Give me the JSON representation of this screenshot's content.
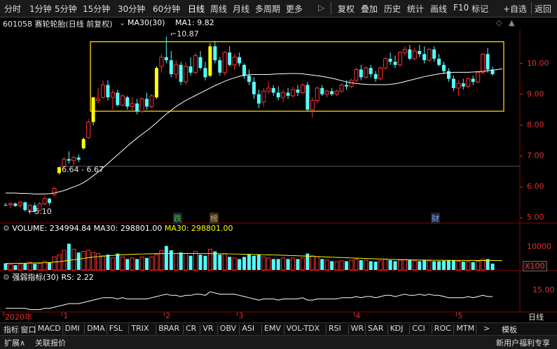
{
  "toolbar": {
    "periods": [
      "分时",
      "1分钟",
      "5分钟",
      "15分钟",
      "30分钟",
      "60分钟",
      "日线",
      "周线",
      "月线",
      "多周期",
      "更多"
    ],
    "active_period": "日线",
    "more_arrow": "▷",
    "actions": [
      "复权",
      "叠加",
      "历史",
      "统计",
      "画线",
      "F10",
      "标记"
    ],
    "add_fav": "+自选",
    "back": "返回"
  },
  "title": {
    "code_name": "601058 赛轮轮胎(日线 前复权)",
    "ma_setting": "MA30(30)",
    "ma_value": "MA1: 9.82",
    "icons": [
      "◇",
      "▲"
    ]
  },
  "annotations": {
    "high": "10.87",
    "low": "5.10",
    "gap": "6.64 - 6.67",
    "event_1": "跌",
    "event_2": "榜",
    "event_3": "财"
  },
  "volume_header": {
    "label": "VOLUME: 234994.84",
    "ma_label": "MA30: 298801.00",
    "ma_label_2": "MA30: 298801.00",
    "unit": "X100"
  },
  "rs_header": {
    "label": "强弱指标(30)",
    "value": "RS: 2.22"
  },
  "colors": {
    "up": "#ff3232",
    "down": "#54ffff",
    "limit": "#ffff00",
    "ma": "#ffffff",
    "box": "#ffd700"
  },
  "chart_data": {
    "type": "candlestick",
    "price_axis": [
      "10.00",
      "9.00",
      "8.00",
      "7.00",
      "6.00",
      "5.00"
    ],
    "price_range": [
      4.85,
      11.1
    ],
    "volume_axis": [
      "10000"
    ],
    "volume_range": [
      0,
      16000
    ],
    "rs_axis": [
      "15.00"
    ],
    "rs_range": [
      0,
      26
    ],
    "date_labels": [
      {
        "label": "2020年",
        "idx": 0
      },
      {
        "label": "1",
        "idx": 12
      },
      {
        "label": "2",
        "idx": 33
      },
      {
        "label": "3",
        "idx": 48
      },
      {
        "label": "4",
        "idx": 72
      },
      {
        "label": "5",
        "idx": 93
      }
    ],
    "candles": [
      {
        "o": 5.42,
        "h": 5.48,
        "l": 5.38,
        "c": 5.4,
        "v": 3000,
        "rs": 3
      },
      {
        "o": 5.42,
        "h": 5.5,
        "l": 5.3,
        "c": 5.46,
        "v": 2500,
        "rs": 3
      },
      {
        "o": 5.46,
        "h": 5.5,
        "l": 5.36,
        "c": 5.38,
        "v": 2200,
        "rs": 3
      },
      {
        "o": 5.4,
        "h": 5.55,
        "l": 5.32,
        "c": 5.5,
        "v": 2600,
        "rs": 3
      },
      {
        "o": 5.5,
        "h": 5.52,
        "l": 5.2,
        "c": 5.25,
        "v": 3000,
        "rs": 3
      },
      {
        "o": 5.25,
        "h": 5.45,
        "l": 5.1,
        "c": 5.4,
        "v": 3500,
        "rs": 2
      },
      {
        "o": 5.4,
        "h": 5.48,
        "l": 5.15,
        "c": 5.2,
        "v": 2800,
        "rs": 2
      },
      {
        "o": 5.25,
        "h": 5.52,
        "l": 5.2,
        "c": 5.45,
        "v": 3000,
        "rs": 2
      },
      {
        "o": 5.45,
        "h": 5.7,
        "l": 5.4,
        "c": 5.62,
        "v": 4000,
        "rs": 3
      },
      {
        "o": 5.62,
        "h": 5.65,
        "l": 5.4,
        "c": 5.48,
        "v": 3500,
        "rs": 3
      },
      {
        "o": 5.75,
        "h": 6.0,
        "l": 5.7,
        "c": 5.95,
        "v": 6000,
        "rs": 4
      },
      {
        "o": 6.45,
        "h": 6.64,
        "l": 6.4,
        "c": 6.64,
        "v": 7000,
        "rs": 5,
        "limit": true
      },
      {
        "o": 6.67,
        "h": 6.95,
        "l": 6.6,
        "c": 6.9,
        "v": 9000,
        "rs": 6
      },
      {
        "o": 6.9,
        "h": 7.15,
        "l": 6.75,
        "c": 6.85,
        "v": 12000,
        "rs": 7
      },
      {
        "o": 6.85,
        "h": 7.0,
        "l": 6.7,
        "c": 6.95,
        "v": 9500,
        "rs": 7
      },
      {
        "o": 6.95,
        "h": 7.05,
        "l": 6.8,
        "c": 6.88,
        "v": 8000,
        "rs": 7
      },
      {
        "o": 7.25,
        "h": 7.6,
        "l": 7.2,
        "c": 7.55,
        "v": 8500,
        "rs": 8,
        "limit": true
      },
      {
        "o": 7.6,
        "h": 8.2,
        "l": 7.55,
        "c": 8.1,
        "v": 9000,
        "rs": 9
      },
      {
        "o": 8.1,
        "h": 8.9,
        "l": 8.0,
        "c": 8.9,
        "v": 8000,
        "rs": 10,
        "limit": true
      },
      {
        "o": 8.8,
        "h": 9.2,
        "l": 8.7,
        "c": 8.85,
        "v": 7500,
        "rs": 11
      },
      {
        "o": 8.9,
        "h": 9.45,
        "l": 8.85,
        "c": 9.3,
        "v": 6500,
        "rs": 12
      },
      {
        "o": 9.3,
        "h": 9.45,
        "l": 8.8,
        "c": 8.9,
        "v": 7000,
        "rs": 12
      },
      {
        "o": 8.9,
        "h": 9.15,
        "l": 8.5,
        "c": 9.05,
        "v": 5500,
        "rs": 12
      },
      {
        "o": 9.05,
        "h": 9.15,
        "l": 8.6,
        "c": 8.65,
        "v": 7500,
        "rs": 11
      },
      {
        "o": 8.65,
        "h": 9.0,
        "l": 8.6,
        "c": 8.95,
        "v": 6000,
        "rs": 12
      },
      {
        "o": 8.9,
        "h": 8.95,
        "l": 8.5,
        "c": 8.6,
        "v": 5000,
        "rs": 11
      },
      {
        "o": 8.6,
        "h": 8.9,
        "l": 8.45,
        "c": 8.7,
        "v": 5500,
        "rs": 11
      },
      {
        "o": 8.7,
        "h": 8.85,
        "l": 8.35,
        "c": 8.45,
        "v": 5000,
        "rs": 11
      },
      {
        "o": 8.45,
        "h": 8.9,
        "l": 8.4,
        "c": 8.85,
        "v": 6000,
        "rs": 11
      },
      {
        "o": 8.85,
        "h": 9.05,
        "l": 8.5,
        "c": 8.6,
        "v": 5500,
        "rs": 11
      },
      {
        "o": 8.6,
        "h": 9.0,
        "l": 8.55,
        "c": 8.95,
        "v": 6000,
        "rs": 12
      },
      {
        "o": 8.9,
        "h": 9.9,
        "l": 8.85,
        "c": 9.85,
        "v": 7000,
        "rs": 13,
        "limit": true
      },
      {
        "o": 9.9,
        "h": 10.3,
        "l": 9.7,
        "c": 10.2,
        "v": 9000,
        "rs": 14
      },
      {
        "o": 10.2,
        "h": 10.87,
        "l": 10.0,
        "c": 10.1,
        "v": 11000,
        "rs": 15
      },
      {
        "o": 10.1,
        "h": 10.4,
        "l": 9.55,
        "c": 9.65,
        "v": 9000,
        "rs": 14
      },
      {
        "o": 9.65,
        "h": 10.1,
        "l": 9.5,
        "c": 9.95,
        "v": 7500,
        "rs": 14
      },
      {
        "o": 9.95,
        "h": 10.05,
        "l": 9.3,
        "c": 9.4,
        "v": 8000,
        "rs": 13
      },
      {
        "o": 9.4,
        "h": 10.05,
        "l": 9.3,
        "c": 9.9,
        "v": 7500,
        "rs": 14
      },
      {
        "o": 9.9,
        "h": 10.2,
        "l": 9.6,
        "c": 9.7,
        "v": 6500,
        "rs": 14
      },
      {
        "o": 9.7,
        "h": 10.35,
        "l": 9.65,
        "c": 10.25,
        "v": 8500,
        "rs": 15
      },
      {
        "o": 10.2,
        "h": 10.4,
        "l": 9.8,
        "c": 9.85,
        "v": 7000,
        "rs": 15
      },
      {
        "o": 9.85,
        "h": 10.05,
        "l": 9.45,
        "c": 9.55,
        "v": 6500,
        "rs": 14
      },
      {
        "o": 9.6,
        "h": 10.65,
        "l": 9.55,
        "c": 10.55,
        "v": 9500,
        "rs": 17,
        "limit": true
      },
      {
        "o": 10.55,
        "h": 10.7,
        "l": 10.0,
        "c": 10.1,
        "v": 8500,
        "rs": 16
      },
      {
        "o": 10.1,
        "h": 10.2,
        "l": 9.6,
        "c": 9.7,
        "v": 7000,
        "rs": 15
      },
      {
        "o": 9.7,
        "h": 10.4,
        "l": 9.6,
        "c": 10.35,
        "v": 7500,
        "rs": 15
      },
      {
        "o": 10.35,
        "h": 10.55,
        "l": 9.9,
        "c": 9.95,
        "v": 6000,
        "rs": 15
      },
      {
        "o": 9.95,
        "h": 10.3,
        "l": 9.8,
        "c": 10.2,
        "v": 5500,
        "rs": 15
      },
      {
        "o": 10.2,
        "h": 10.35,
        "l": 9.9,
        "c": 10.0,
        "v": 5000,
        "rs": 14
      },
      {
        "o": 9.95,
        "h": 10.0,
        "l": 9.5,
        "c": 9.6,
        "v": 6000,
        "rs": 13
      },
      {
        "o": 9.6,
        "h": 9.8,
        "l": 9.3,
        "c": 9.4,
        "v": 7000,
        "rs": 12
      },
      {
        "o": 9.4,
        "h": 9.55,
        "l": 8.85,
        "c": 9.0,
        "v": 6500,
        "rs": 11
      },
      {
        "o": 9.0,
        "h": 9.15,
        "l": 8.55,
        "c": 8.7,
        "v": 7000,
        "rs": 10
      },
      {
        "o": 8.75,
        "h": 9.2,
        "l": 8.6,
        "c": 9.1,
        "v": 6000,
        "rs": 11
      },
      {
        "o": 9.1,
        "h": 9.4,
        "l": 9.0,
        "c": 9.2,
        "v": 5500,
        "rs": 11
      },
      {
        "o": 9.2,
        "h": 9.3,
        "l": 8.95,
        "c": 9.05,
        "v": 5000,
        "rs": 11
      },
      {
        "o": 9.05,
        "h": 9.25,
        "l": 8.8,
        "c": 8.9,
        "v": 5000,
        "rs": 10
      },
      {
        "o": 8.9,
        "h": 9.15,
        "l": 8.75,
        "c": 9.05,
        "v": 5500,
        "rs": 11
      },
      {
        "o": 9.05,
        "h": 9.2,
        "l": 8.85,
        "c": 8.95,
        "v": 5000,
        "rs": 11
      },
      {
        "o": 8.95,
        "h": 9.25,
        "l": 8.9,
        "c": 9.15,
        "v": 5500,
        "rs": 11
      },
      {
        "o": 9.15,
        "h": 9.3,
        "l": 8.95,
        "c": 9.05,
        "v": 5000,
        "rs": 11
      },
      {
        "o": 9.05,
        "h": 9.35,
        "l": 9.0,
        "c": 9.3,
        "v": 5500,
        "rs": 12
      },
      {
        "o": 9.3,
        "h": 9.4,
        "l": 8.45,
        "c": 8.5,
        "v": 7500,
        "rs": 10
      },
      {
        "o": 8.5,
        "h": 8.9,
        "l": 8.25,
        "c": 8.8,
        "v": 6500,
        "rs": 10
      },
      {
        "o": 8.8,
        "h": 9.25,
        "l": 8.7,
        "c": 9.2,
        "v": 6000,
        "rs": 11
      },
      {
        "o": 9.2,
        "h": 9.3,
        "l": 8.95,
        "c": 9.0,
        "v": 5000,
        "rs": 11
      },
      {
        "o": 9.0,
        "h": 9.15,
        "l": 8.9,
        "c": 9.1,
        "v": 4500,
        "rs": 11
      },
      {
        "o": 9.1,
        "h": 9.2,
        "l": 8.95,
        "c": 9.0,
        "v": 4000,
        "rs": 11
      },
      {
        "o": 9.0,
        "h": 9.15,
        "l": 8.95,
        "c": 9.1,
        "v": 3800,
        "rs": 11
      },
      {
        "o": 9.1,
        "h": 9.35,
        "l": 9.05,
        "c": 9.3,
        "v": 4200,
        "rs": 12
      },
      {
        "o": 9.3,
        "h": 9.45,
        "l": 9.15,
        "c": 9.25,
        "v": 4000,
        "rs": 12
      },
      {
        "o": 9.25,
        "h": 9.5,
        "l": 9.2,
        "c": 9.45,
        "v": 4500,
        "rs": 12
      },
      {
        "o": 9.45,
        "h": 9.85,
        "l": 9.4,
        "c": 9.8,
        "v": 5000,
        "rs": 13
      },
      {
        "o": 9.8,
        "h": 9.95,
        "l": 9.45,
        "c": 9.55,
        "v": 4500,
        "rs": 12
      },
      {
        "o": 9.55,
        "h": 9.9,
        "l": 9.5,
        "c": 9.85,
        "v": 4500,
        "rs": 13
      },
      {
        "o": 9.85,
        "h": 9.95,
        "l": 9.55,
        "c": 9.65,
        "v": 4000,
        "rs": 13
      },
      {
        "o": 9.65,
        "h": 9.75,
        "l": 9.4,
        "c": 9.5,
        "v": 3800,
        "rs": 12
      },
      {
        "o": 9.5,
        "h": 9.9,
        "l": 9.45,
        "c": 9.85,
        "v": 4200,
        "rs": 13
      },
      {
        "o": 9.85,
        "h": 10.2,
        "l": 9.8,
        "c": 10.15,
        "v": 5000,
        "rs": 14
      },
      {
        "o": 10.15,
        "h": 10.35,
        "l": 9.95,
        "c": 10.05,
        "v": 4500,
        "rs": 14
      },
      {
        "o": 10.05,
        "h": 10.25,
        "l": 9.85,
        "c": 9.95,
        "v": 4000,
        "rs": 13
      },
      {
        "o": 9.95,
        "h": 10.4,
        "l": 9.9,
        "c": 10.35,
        "v": 4500,
        "rs": 14
      },
      {
        "o": 10.35,
        "h": 10.55,
        "l": 10.25,
        "c": 10.45,
        "v": 4800,
        "rs": 15
      },
      {
        "o": 10.45,
        "h": 10.6,
        "l": 10.1,
        "c": 10.15,
        "v": 4500,
        "rs": 14
      },
      {
        "o": 10.15,
        "h": 10.5,
        "l": 10.1,
        "c": 10.4,
        "v": 4200,
        "rs": 14
      },
      {
        "o": 10.4,
        "h": 10.6,
        "l": 10.2,
        "c": 10.3,
        "v": 4000,
        "rs": 15
      },
      {
        "o": 10.3,
        "h": 10.55,
        "l": 10.0,
        "c": 10.1,
        "v": 4500,
        "rs": 14
      },
      {
        "o": 10.1,
        "h": 10.5,
        "l": 10.05,
        "c": 10.45,
        "v": 4200,
        "rs": 15
      },
      {
        "o": 10.45,
        "h": 10.55,
        "l": 10.05,
        "c": 10.15,
        "v": 4000,
        "rs": 14
      },
      {
        "o": 10.15,
        "h": 10.3,
        "l": 9.9,
        "c": 9.95,
        "v": 4000,
        "rs": 14
      },
      {
        "o": 9.95,
        "h": 10.05,
        "l": 9.65,
        "c": 9.75,
        "v": 4200,
        "rs": 13
      },
      {
        "o": 9.75,
        "h": 9.85,
        "l": 9.4,
        "c": 9.5,
        "v": 4500,
        "rs": 12
      },
      {
        "o": 9.5,
        "h": 9.6,
        "l": 9.1,
        "c": 9.2,
        "v": 4500,
        "rs": 12
      },
      {
        "o": 9.2,
        "h": 9.45,
        "l": 8.95,
        "c": 9.35,
        "v": 4000,
        "rs": 12
      },
      {
        "o": 9.35,
        "h": 9.5,
        "l": 9.15,
        "c": 9.25,
        "v": 3800,
        "rs": 12
      },
      {
        "o": 9.25,
        "h": 9.55,
        "l": 9.2,
        "c": 9.5,
        "v": 3800,
        "rs": 13
      },
      {
        "o": 9.5,
        "h": 9.6,
        "l": 9.3,
        "c": 9.4,
        "v": 3600,
        "rs": 12
      },
      {
        "o": 9.4,
        "h": 9.75,
        "l": 9.35,
        "c": 9.7,
        "v": 4000,
        "rs": 13
      },
      {
        "o": 9.7,
        "h": 10.35,
        "l": 9.65,
        "c": 10.3,
        "v": 5000,
        "rs": 14
      },
      {
        "o": 10.3,
        "h": 10.5,
        "l": 9.7,
        "c": 9.8,
        "v": 5000,
        "rs": 13
      },
      {
        "o": 9.8,
        "h": 9.9,
        "l": 9.6,
        "c": 9.65,
        "v": 2900,
        "rs": 13
      }
    ],
    "ma30": [
      5.8,
      5.8,
      5.8,
      5.79,
      5.79,
      5.78,
      5.77,
      5.77,
      5.77,
      5.78,
      5.8,
      5.84,
      5.88,
      5.94,
      6.0,
      6.06,
      6.14,
      6.24,
      6.36,
      6.48,
      6.62,
      6.76,
      6.9,
      7.04,
      7.18,
      7.32,
      7.45,
      7.58,
      7.7,
      7.82,
      7.94,
      8.08,
      8.22,
      8.36,
      8.48,
      8.6,
      8.7,
      8.8,
      8.88,
      8.96,
      9.04,
      9.12,
      9.2,
      9.28,
      9.35,
      9.42,
      9.48,
      9.53,
      9.58,
      9.61,
      9.63,
      9.64,
      9.64,
      9.64,
      9.64,
      9.65,
      9.66,
      9.66,
      9.67,
      9.67,
      9.67,
      9.66,
      9.64,
      9.62,
      9.6,
      9.58,
      9.55,
      9.52,
      9.48,
      9.44,
      9.4,
      9.37,
      9.35,
      9.33,
      9.32,
      9.31,
      9.31,
      9.31,
      9.31,
      9.32,
      9.34,
      9.37,
      9.41,
      9.45,
      9.49,
      9.53,
      9.57,
      9.6,
      9.63,
      9.66,
      9.68,
      9.7,
      9.71,
      9.71,
      9.71,
      9.71,
      9.72,
      9.73,
      9.74,
      9.76,
      9.78,
      9.8,
      9.82
    ],
    "vol_ma30": [
      3000,
      3000,
      3000,
      3050,
      3100,
      3150,
      3200,
      3250,
      3300,
      3400,
      3600,
      3800,
      4100,
      4400,
      4700,
      5000,
      5300,
      5600,
      5900,
      6100,
      6300,
      6500,
      6650,
      6800,
      6950,
      7050,
      7150,
      7250,
      7300,
      7350,
      7400,
      7450,
      7480,
      7500,
      7520,
      7540,
      7550,
      7550,
      7540,
      7520,
      7500,
      7480,
      7460,
      7440,
      7410,
      7380,
      7340,
      7300,
      7260,
      7210,
      7160,
      7100,
      7040,
      6980,
      6920,
      6860,
      6790,
      6720,
      6650,
      6570,
      6490,
      6400,
      6310,
      6220,
      6130,
      6040,
      5950,
      5860,
      5770,
      5680,
      5590,
      5500,
      5410,
      5320,
      5230,
      5150,
      5070,
      4990,
      4920,
      4850,
      4790,
      4730,
      4680,
      4630,
      4590,
      4550,
      4520,
      4490,
      4460,
      4440,
      4420,
      4400,
      4390,
      4380,
      4370,
      4360,
      4350,
      4340,
      4330,
      4320,
      4310,
      4300,
      4290
    ]
  },
  "bottom_tabs": [
    "指标",
    "窗口",
    "MACD",
    "DMI",
    "DMA",
    "FSL",
    "TRIX",
    "BRAR",
    "CR",
    "VR",
    "OBV",
    "ASI",
    "EMV",
    "VOL-TDX",
    "RSI",
    "WR",
    "SAR",
    "KDJ",
    "CCI",
    "ROC",
    "MTM"
  ],
  "bottom_right": {
    "arrow": ">",
    "template": "模板",
    "period": "日线"
  },
  "status": {
    "expand": "扩展∧",
    "related": "关联报价",
    "news": "新用户福利专享"
  }
}
